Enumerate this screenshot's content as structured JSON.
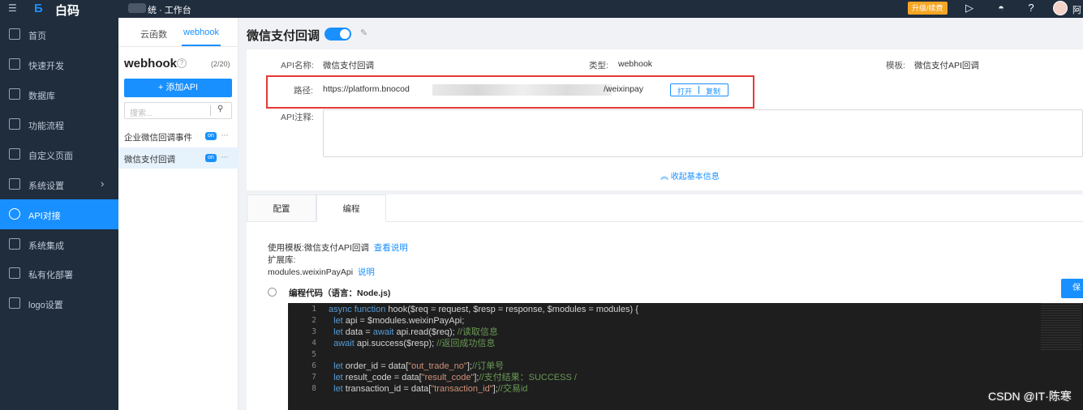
{
  "topbar": {
    "menu_icon": "menu-fold-icon",
    "logo_text": "白码",
    "workspace": "统 · 工作台",
    "upgrade_label": "升级/续费",
    "user_name": "阿"
  },
  "sidebar": {
    "items": [
      {
        "label": "首页",
        "icon": "home-icon"
      },
      {
        "label": "快速开发",
        "icon": "cube-icon"
      },
      {
        "label": "数据库",
        "icon": "database-icon"
      },
      {
        "label": "功能流程",
        "icon": "flow-icon"
      },
      {
        "label": "自定义页面",
        "icon": "page-icon"
      },
      {
        "label": "系统设置",
        "icon": "settings-icon"
      },
      {
        "label": "API对接",
        "icon": "api-icon"
      },
      {
        "label": "系统集成",
        "icon": "layers-icon"
      },
      {
        "label": "私有化部署",
        "icon": "server-icon"
      },
      {
        "label": "logo设置",
        "icon": "logo-icon"
      }
    ]
  },
  "panel2": {
    "tabs": [
      "云函数",
      "webhook"
    ],
    "title": "webhook",
    "count": "(2/20)",
    "add_button": "+ 添加API",
    "search_placeholder": "搜索...",
    "list": [
      {
        "label": "企业微信回调事件",
        "badge": "on"
      },
      {
        "label": "微信支付回调",
        "badge": "on"
      }
    ]
  },
  "main": {
    "title": "微信支付回调",
    "info": {
      "name_label": "API名称:",
      "name_value": "微信支付回调",
      "type_label": "类型:",
      "type_value": "webhook",
      "template_label": "模板:",
      "template_value": "微信支付API回调",
      "path_label": "路径:",
      "path_prefix": "https://platform.bnocod",
      "path_suffix": "/weixinpay",
      "open_btn": "打开",
      "copy_btn": "复制",
      "comment_label": "API注释:",
      "collapse_label": "收起基本信息"
    },
    "tabs": [
      "配置",
      "编程"
    ],
    "usage_template_label": "使用模板:",
    "usage_template_value": "微信支付API回调",
    "view_doc": "查看说明",
    "ext_label": "扩展库:",
    "ext_value": "modules.weixinPayApi",
    "ext_doc": "说明",
    "code_label": "编程代码（语言：Node.js)",
    "save_btn": "保"
  },
  "code": {
    "lines": [
      {
        "n": "1",
        "html": "<span class='kw'>async function</span> hook($req = request, $resp = response, $modules = modules) {"
      },
      {
        "n": "2",
        "html": "  <span class='kw'>let</span> api = $modules.weixinPayApi;"
      },
      {
        "n": "3",
        "html": "  <span class='kw'>let</span> data = <span class='kw'>await</span> api.read($req); <span class='cm'>//读取信息</span>"
      },
      {
        "n": "4",
        "html": "  <span class='kw'>await</span> api.success($resp); <span class='cm'>//返回成功信息</span>"
      },
      {
        "n": "5",
        "html": ""
      },
      {
        "n": "6",
        "html": "  <span class='kw'>let</span> order_id = data[<span class='str'>\"out_trade_no\"</span>];<span class='cm'>//订单号</span>"
      },
      {
        "n": "7",
        "html": "  <span class='kw'>let</span> result_code = data[<span class='str'>\"result_code\"</span>];<span class='cm'>//支付结果：SUCCESS /</span>"
      },
      {
        "n": "8",
        "html": "  <span class='kw'>let</span> transaction_id = data[<span class='str'>\"transaction_id\"</span>];<span class='cm'>//交易id</span>"
      }
    ]
  },
  "watermark": "CSDN @IT·陈寒"
}
